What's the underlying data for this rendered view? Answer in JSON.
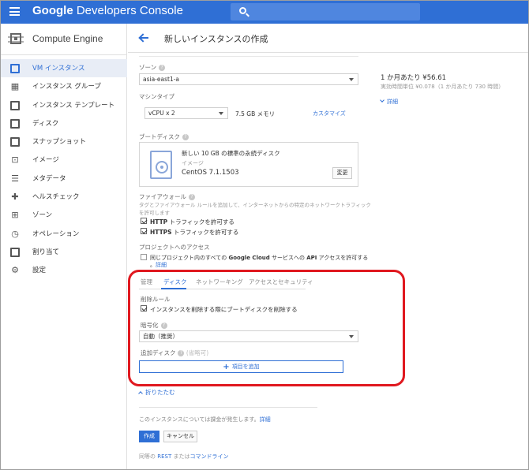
{
  "appbar": {
    "brand_google": "Google",
    "brand_product": "Developers Console"
  },
  "sidebar": {
    "product": "Compute Engine",
    "items": [
      {
        "label": "VM インスタンス",
        "icon": "vm-instance-icon",
        "active": true
      },
      {
        "label": "インスタンス グループ",
        "icon": "instance-group-icon"
      },
      {
        "label": "インスタンス テンプレート",
        "icon": "instance-template-icon"
      },
      {
        "label": "ディスク",
        "icon": "disk-icon"
      },
      {
        "label": "スナップショット",
        "icon": "snapshot-icon"
      },
      {
        "label": "イメージ",
        "icon": "image-icon"
      },
      {
        "label": "メタデータ",
        "icon": "metadata-icon"
      },
      {
        "label": "ヘルスチェック",
        "icon": "health-check-icon"
      },
      {
        "label": "ゾーン",
        "icon": "zone-icon"
      },
      {
        "label": "オペレーション",
        "icon": "operations-icon"
      },
      {
        "label": "割り当て",
        "icon": "quota-icon"
      },
      {
        "label": "設定",
        "icon": "gear-icon"
      }
    ]
  },
  "header": {
    "title": "新しいインスタンスの作成"
  },
  "form": {
    "zone_label": "ゾーン",
    "zone_value": "asia-east1-a",
    "machine_label": "マシンタイプ",
    "machine_value": "vCPU x 2",
    "memory": "7.5 GB メモリ",
    "customize": "カスタマイズ",
    "boot_label": "ブートディスク",
    "boot_title": "新しい 10 GB の標準の永続ディスク",
    "boot_image_label": "イメージ",
    "boot_image": "CentOS 7.1.1503",
    "change": "変更",
    "firewall_label": "ファイアウォール",
    "firewall_desc_1": "タグとファイアウォール ルールを追加して、インターネットからの特定のネットワークトラフィック",
    "firewall_desc_2": "を許可します",
    "http_prefix": "HTTP",
    "http_rest": " トラフィックを許可する",
    "https_prefix": "HTTPS",
    "https_rest": " トラフィックを許可する",
    "project_access_label": "プロジェクトへのアクセス",
    "project_access_1a": "同じプロジェクト内のすべての ",
    "project_access_1b": "Google Cloud",
    "project_access_1c": " サービスへの ",
    "project_access_1d": "API",
    "project_access_1e": " アクセスを許可する",
    "project_access_2": "。",
    "project_access_link": "詳細",
    "tabs": [
      "管理",
      "ディスク",
      "ネットワーキング",
      "アクセスとセキュリティ"
    ],
    "delete_rule_label": "削除ルール",
    "delete_rule_check": "インスタンスを削除する際にブートディスクを削除する",
    "encryption_label": "暗号化",
    "encryption_value": "自動（推奨）",
    "add_disk_label": "追加ディスク",
    "add_disk_hint": "(省略可)",
    "add_item": "項目を追加",
    "collapse": "折りたたむ",
    "billing_note": "このインスタンスについては課金が発生します。",
    "billing_link": "詳細",
    "create": "作成",
    "cancel": "キャンセル",
    "rest_prefix": "同等の ",
    "rest_link": "REST",
    "rest_mid": " または",
    "rest_cli": "コマンドライン"
  },
  "price": {
    "monthly": "1 か月あたり ¥56.61",
    "hourly": "実効時間単位 ¥0.078（1 か月あたり 730 時間）",
    "details": "詳細"
  },
  "colors": {
    "appbar": "#2f6fd5",
    "highlight": "#e0181f"
  }
}
